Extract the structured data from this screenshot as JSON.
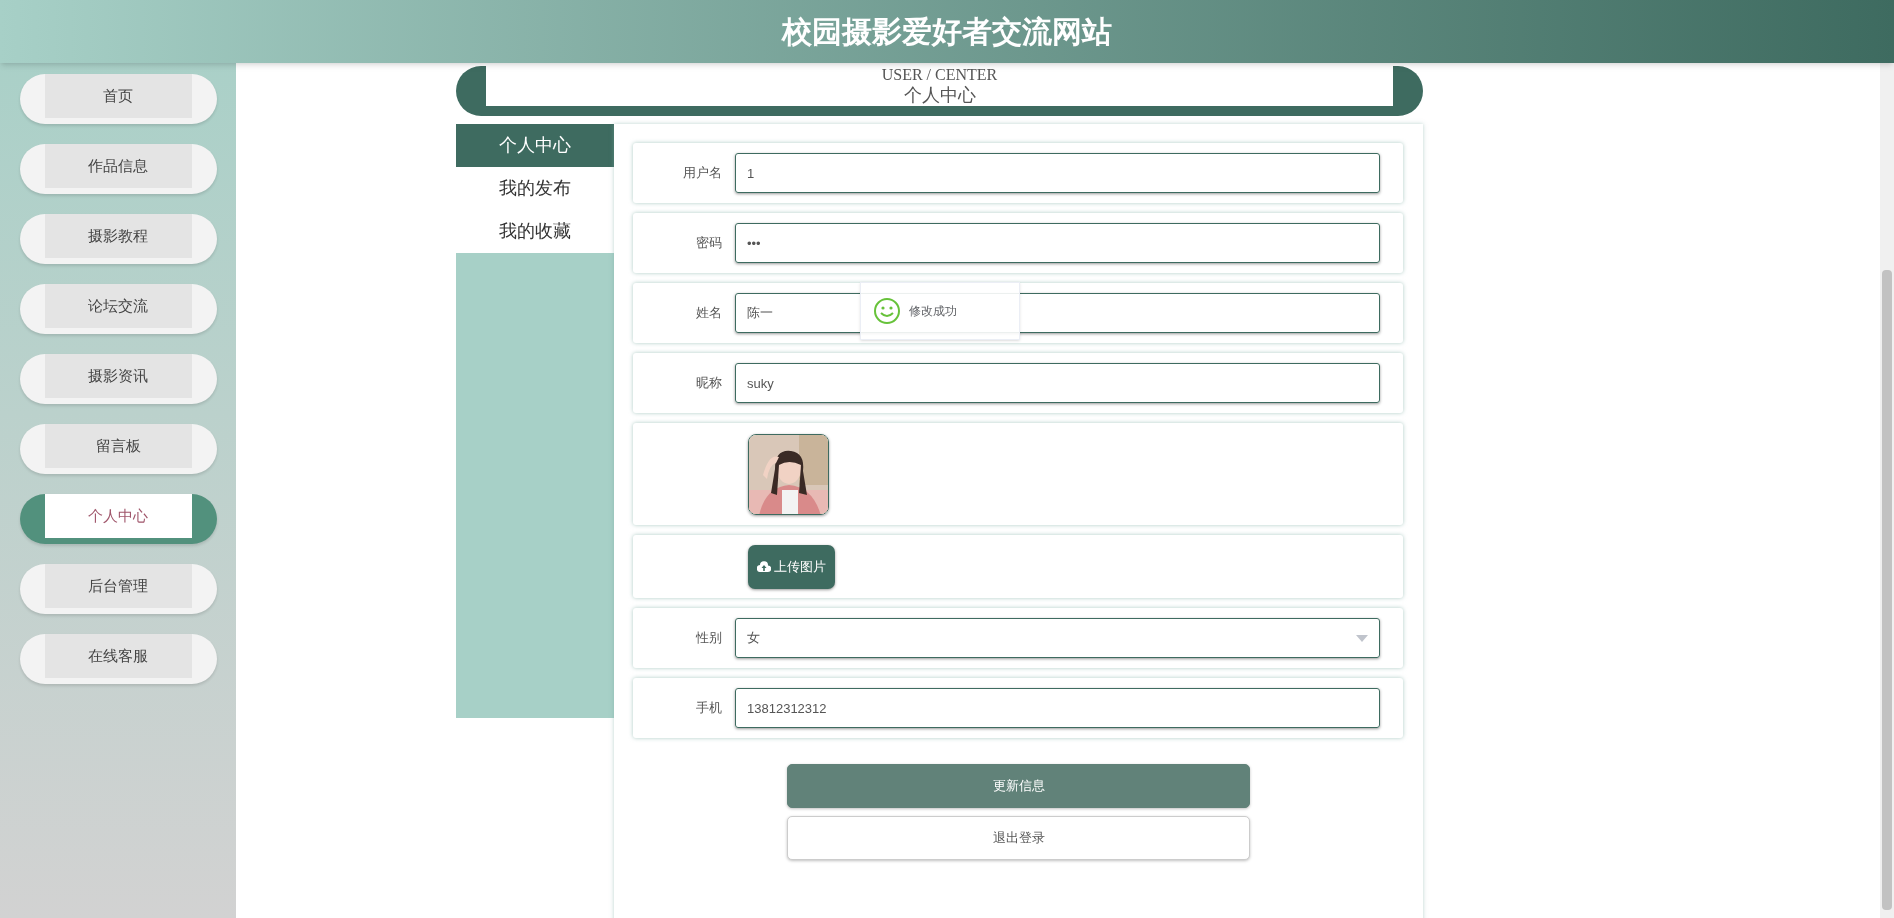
{
  "header": {
    "title": "校园摄影爱好者交流网站"
  },
  "sidebar": {
    "items": [
      {
        "label": "首页",
        "selected": false
      },
      {
        "label": "作品信息",
        "selected": false
      },
      {
        "label": "摄影教程",
        "selected": false
      },
      {
        "label": "论坛交流",
        "selected": false
      },
      {
        "label": "摄影资讯",
        "selected": false
      },
      {
        "label": "留言板",
        "selected": false
      },
      {
        "label": "个人中心",
        "selected": true
      },
      {
        "label": "后台管理",
        "selected": false
      },
      {
        "label": "在线客服",
        "selected": false
      }
    ]
  },
  "banner": {
    "subtitle": "USER / CENTER",
    "title": "个人中心"
  },
  "tabs": [
    {
      "label": "个人中心",
      "selected": true
    },
    {
      "label": "我的发布",
      "selected": false
    },
    {
      "label": "我的收藏",
      "selected": false
    }
  ],
  "form": {
    "fields": [
      {
        "kind": "text",
        "label": "用户名",
        "value": "1"
      },
      {
        "kind": "text",
        "label": "密码",
        "value": "•••"
      },
      {
        "kind": "text",
        "label": "姓名",
        "value": "陈一"
      },
      {
        "kind": "text",
        "label": "昵称",
        "value": "suky"
      },
      {
        "kind": "avatar"
      },
      {
        "kind": "upload",
        "button": "上传图片"
      },
      {
        "kind": "select",
        "label": "性别",
        "value": "女"
      },
      {
        "kind": "text",
        "label": "手机",
        "value": "13812312312"
      }
    ],
    "buttons": [
      {
        "label": "更新信息",
        "kind": "primary"
      },
      {
        "label": "退出登录",
        "kind": "secondary"
      }
    ]
  },
  "toast": {
    "message": "修改成功"
  }
}
